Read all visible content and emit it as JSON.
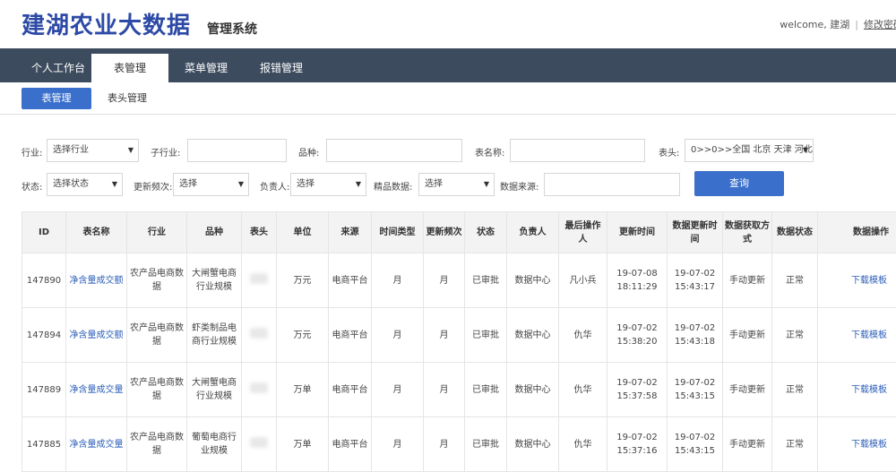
{
  "header": {
    "logo_title": "建湖农业大数据",
    "logo_subtitle": "管理系统",
    "welcome_text": "welcome, 建湖",
    "separator": "|",
    "change_password": "修改密码"
  },
  "nav": {
    "tabs": [
      {
        "label": "个人工作台"
      },
      {
        "label": "表管理"
      },
      {
        "label": "菜单管理"
      },
      {
        "label": "报错管理"
      }
    ]
  },
  "subnav": {
    "tabs": [
      {
        "label": "表管理"
      },
      {
        "label": "表头管理"
      }
    ]
  },
  "filters": {
    "industry_label": "行业:",
    "industry_value": "选择行业",
    "subindustry_label": "子行业:",
    "subindustry_value": "",
    "variety_label": "品种:",
    "variety_value": "",
    "tablename_label": "表名称:",
    "tablename_value": "",
    "header_label": "表头:",
    "header_value": "0>>0>>全国 北京 天津 河北",
    "status_label": "状态:",
    "status_value": "选择状态",
    "frequency_label": "更新频次:",
    "frequency_value": "选择",
    "owner_label": "负责人:",
    "owner_value": "选择",
    "premium_label": "精品数据:",
    "premium_value": "选择",
    "source_label": "数据来源:",
    "source_value": "",
    "query_button": "查询"
  },
  "table": {
    "columns": [
      "ID",
      "表名称",
      "行业",
      "品种",
      "表头",
      "单位",
      "来源",
      "时间类型",
      "更新频次",
      "状态",
      "负责人",
      "最后操作人",
      "更新时间",
      "数据更新时间",
      "数据获取方式",
      "数据状态",
      "数据操作"
    ],
    "rows": [
      {
        "id": "147890",
        "name": "净含量成交额",
        "industry": "农产品电商数据",
        "variety": "大闸蟹电商行业规模",
        "unit": "万元",
        "source": "电商平台",
        "time_type": "月",
        "frequency": "月",
        "status": "已审批",
        "owner": "数据中心",
        "last_operator": "凡小兵",
        "update_time": "19-07-08 18:11:29",
        "data_update_time": "19-07-02 15:43:17",
        "acquire": "手动更新",
        "data_status": "正常",
        "op": "下载模板"
      },
      {
        "id": "147894",
        "name": "净含量成交额",
        "industry": "农产品电商数据",
        "variety": "虾类制品电商行业规模",
        "unit": "万元",
        "source": "电商平台",
        "time_type": "月",
        "frequency": "月",
        "status": "已审批",
        "owner": "数据中心",
        "last_operator": "仇华",
        "update_time": "19-07-02 15:38:20",
        "data_update_time": "19-07-02 15:43:18",
        "acquire": "手动更新",
        "data_status": "正常",
        "op": "下载模板"
      },
      {
        "id": "147889",
        "name": "净含量成交量",
        "industry": "农产品电商数据",
        "variety": "大闸蟹电商行业规模",
        "unit": "万单",
        "source": "电商平台",
        "time_type": "月",
        "frequency": "月",
        "status": "已审批",
        "owner": "数据中心",
        "last_operator": "仇华",
        "update_time": "19-07-02 15:37:58",
        "data_update_time": "19-07-02 15:43:15",
        "acquire": "手动更新",
        "data_status": "正常",
        "op": "下载模板"
      },
      {
        "id": "147885",
        "name": "净含量成交量",
        "industry": "农产品电商数据",
        "variety": "葡萄电商行业规模",
        "unit": "万单",
        "source": "电商平台",
        "time_type": "月",
        "frequency": "月",
        "status": "已审批",
        "owner": "数据中心",
        "last_operator": "仇华",
        "update_time": "19-07-02 15:37:16",
        "data_update_time": "19-07-02 15:43:15",
        "acquire": "手动更新",
        "data_status": "正常",
        "op": "下载模板"
      }
    ]
  }
}
